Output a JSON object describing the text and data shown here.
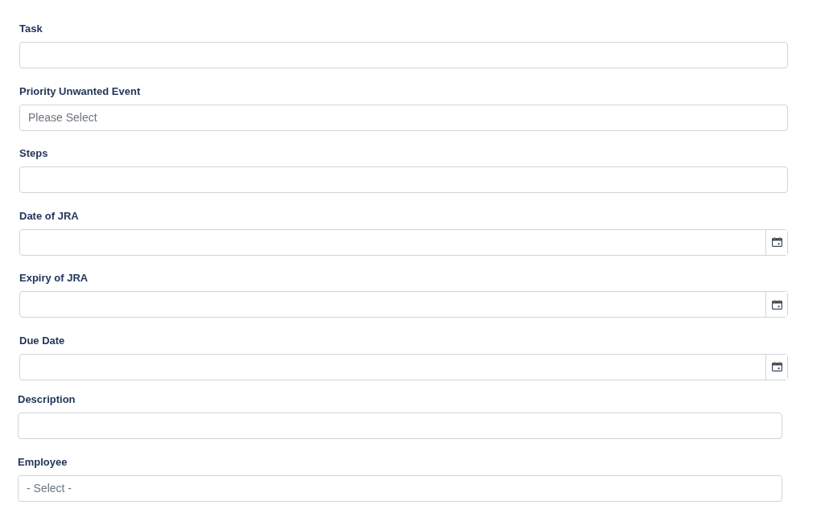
{
  "sections": [
    {
      "fields": [
        {
          "label": "Task",
          "kind": "text"
        },
        {
          "label": "Priority Unwanted Event",
          "kind": "select",
          "placeholder": "Please Select"
        },
        {
          "label": "Steps",
          "kind": "text"
        },
        {
          "label": "Date of JRA",
          "kind": "date"
        },
        {
          "label": "Expiry of JRA",
          "kind": "date"
        },
        {
          "label": "Due Date",
          "kind": "date"
        }
      ]
    },
    {
      "fields": [
        {
          "label": "Description",
          "kind": "text"
        },
        {
          "label": "Employee",
          "kind": "select",
          "placeholder": "- Select -"
        }
      ]
    }
  ]
}
